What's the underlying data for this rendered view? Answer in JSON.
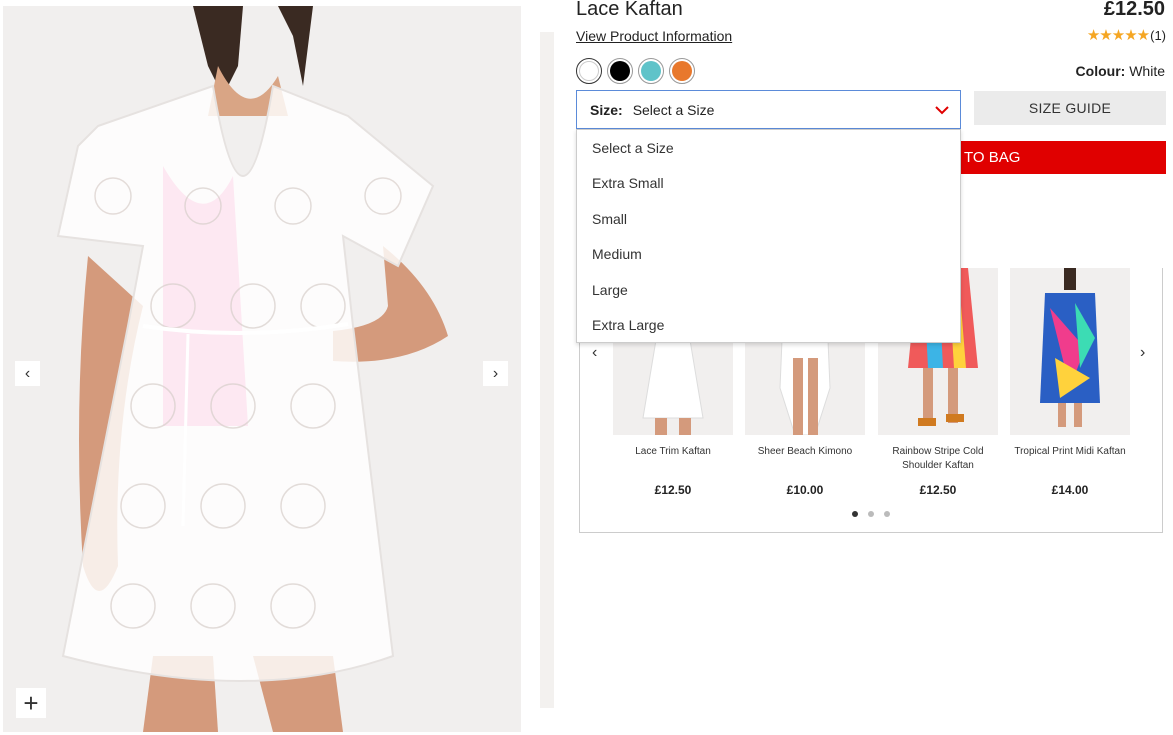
{
  "product": {
    "title": "Lace Kaftan",
    "price": "£12.50",
    "view_info_link": "View Product Information",
    "rating_count": "(1)",
    "rating_stars": 5,
    "colour_label": "Colour:",
    "colour_value": "White",
    "swatches": [
      {
        "name": "White",
        "color": "#ffffff"
      },
      {
        "name": "Black",
        "color": "#000000"
      },
      {
        "name": "Aqua",
        "color": "#5fc3c9"
      },
      {
        "name": "Orange",
        "color": "#e8782c"
      }
    ]
  },
  "size_select": {
    "label": "Size:",
    "value": "Select a Size",
    "options": [
      "Select a Size",
      "Extra Small",
      "Small",
      "Medium",
      "Large",
      "Extra Large"
    ]
  },
  "buttons": {
    "size_guide": "SIZE GUIDE",
    "add_to_bag": "TO BAG"
  },
  "gallery": {
    "prev": "‹",
    "next": "›",
    "zoom": "+"
  },
  "carousel": {
    "prev": "‹",
    "next": "›",
    "items": [
      {
        "name": "Lace Trim Kaftan",
        "price": "£12.50"
      },
      {
        "name": "Sheer Beach Kimono",
        "price": "£10.00"
      },
      {
        "name": "Rainbow Stripe Cold Shoulder Kaftan",
        "price": "£12.50"
      },
      {
        "name": "Tropical Print Midi Kaftan",
        "price": "£14.00"
      }
    ],
    "active_dot": 0,
    "dot_count": 3
  }
}
